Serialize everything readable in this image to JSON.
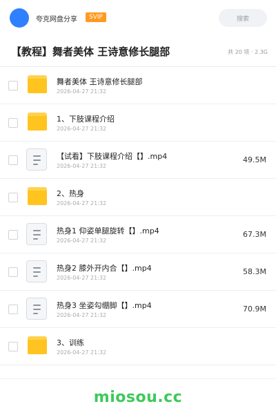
{
  "header": {
    "app_name": "夸克网盘分享",
    "badge": "SVIP",
    "search_placeholder": "搜索"
  },
  "share": {
    "title": "【教程】舞者美体 王诗意修长腿部",
    "meta": "共 20 项 · 2.3G"
  },
  "items": [
    {
      "type": "folder",
      "name": "舞者美体 王诗意修长腿部",
      "date": "2026-04-27 21:32",
      "size": ""
    },
    {
      "type": "folder",
      "name": "1、下肢课程介绍",
      "date": "2026-04-27 21:32",
      "size": ""
    },
    {
      "type": "file",
      "name": "【试看】下肢课程介绍【】.mp4",
      "date": "2026-04-27 21:32",
      "size": "49.5M"
    },
    {
      "type": "folder",
      "name": "2、热身",
      "date": "2026-04-27 21:32",
      "size": ""
    },
    {
      "type": "file",
      "name": "热身1 仰姿单腿旋转【】.mp4",
      "date": "2026-04-27 21:32",
      "size": "67.3M"
    },
    {
      "type": "file",
      "name": "热身2 膝外开内合【】.mp4",
      "date": "2026-04-27 21:32",
      "size": "58.3M"
    },
    {
      "type": "file",
      "name": "热身3 坐姿勾绷脚【】.mp4",
      "date": "2026-04-27 21:32",
      "size": "70.9M"
    },
    {
      "type": "folder",
      "name": "3、训练",
      "date": "2026-04-27 21:32",
      "size": ""
    }
  ],
  "footer": {
    "watermark": "miosou.cc"
  },
  "colors": {
    "accent": "#2f80ff",
    "badge": "#ff9a1f",
    "folder": "#ffc41f",
    "watermark": "#3dc95a"
  }
}
